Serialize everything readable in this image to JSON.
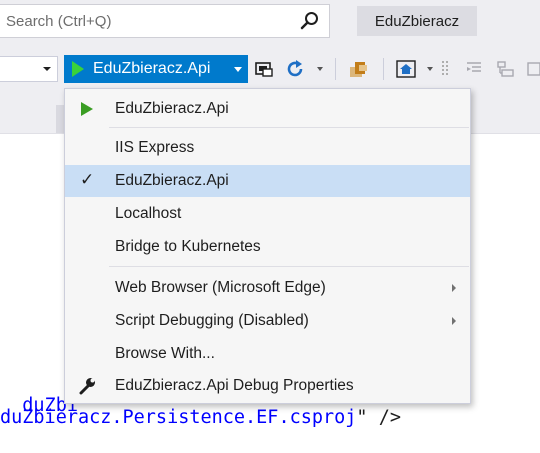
{
  "search": {
    "placeholder": "Search (Ctrl+Q)"
  },
  "title_chip": "EduZbieracz",
  "toolbar": {
    "run_target": "EduZbieracz.Api",
    "icons": [
      "browser-link-icon",
      "refresh-icon",
      "open-folder-icon",
      "home-icon",
      "align-icon",
      "indent-icon"
    ]
  },
  "code": {
    "line1": "duZbi",
    "line2_value": "duZbieracz.Persistence.EF.csproj",
    "line2_end": "\" />"
  },
  "menu": {
    "items": [
      {
        "label": "EduZbieracz.Api",
        "marker": "play"
      },
      {
        "label": "IIS Express"
      },
      {
        "label": "EduZbieracz.Api",
        "checked": true,
        "highlighted": true,
        "check_glyph": "✓"
      },
      {
        "label": "Localhost"
      },
      {
        "label": "Bridge to Kubernetes"
      },
      {
        "label": "Web Browser (Microsoft Edge)",
        "submenu": true
      },
      {
        "label": "Script Debugging (Disabled)",
        "submenu": true
      },
      {
        "label": "Browse With..."
      },
      {
        "label": "EduZbieracz.Api Debug Properties",
        "marker": "wrench"
      }
    ]
  },
  "colors": {
    "accent": "#007acc",
    "highlight": "#c9def5",
    "play": "#3ad23a",
    "code_blue": "#0000ff"
  }
}
